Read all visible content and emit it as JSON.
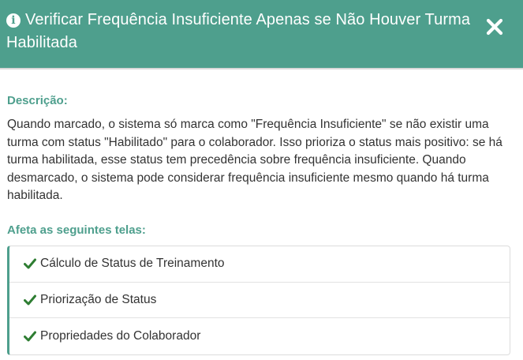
{
  "header": {
    "title": "Verificar Frequência Insuficiente Apenas se Não Houver Turma Habilitada",
    "info_icon": "info-circle-icon",
    "close_icon": "close-icon"
  },
  "description": {
    "title": "Descrição:",
    "text": "Quando marcado, o sistema só marca como \"Frequência Insuficiente\" se não existir uma turma com status \"Habilitado\" para o colaborador. Isso prioriza o status mais positivo: se há turma habilitada, esse status tem precedência sobre frequência insuficiente. Quando desmarcado, o sistema pode considerar frequência insuficiente mesmo quando há turma habilitada."
  },
  "affects": {
    "title": "Afeta as seguintes telas:",
    "items": [
      {
        "label": "Cálculo de Status de Treinamento",
        "icon": "check-icon"
      },
      {
        "label": "Priorização de Status",
        "icon": "check-icon"
      },
      {
        "label": "Propriedades do Colaborador",
        "icon": "check-icon"
      }
    ]
  },
  "colors": {
    "header_bg": "#4e9f8d",
    "accent": "#4e9f8d",
    "check": "#2e7d32",
    "text": "#333333"
  }
}
